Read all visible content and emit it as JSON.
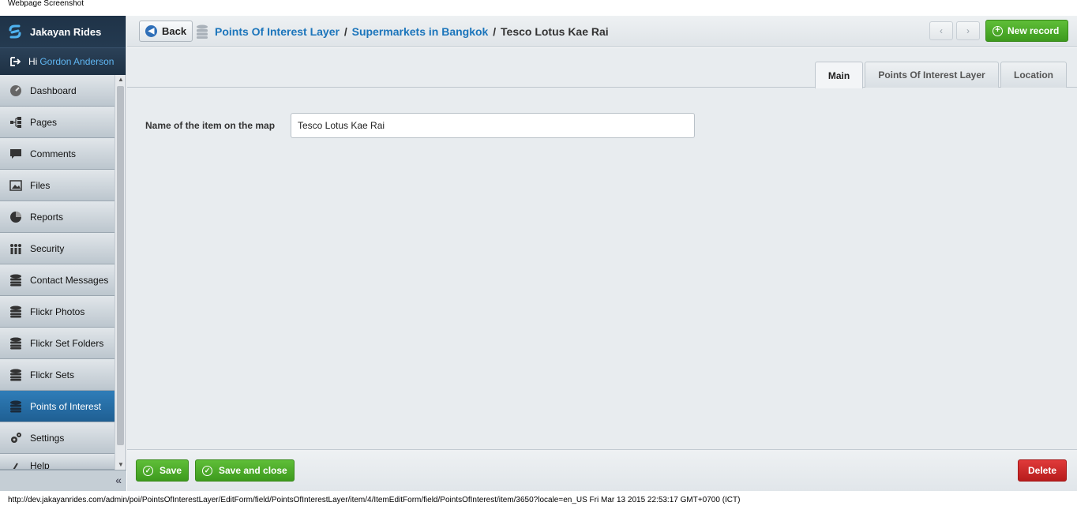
{
  "window": {
    "caption": "Webpage Screenshot"
  },
  "app": {
    "name": "Jakayan Rides"
  },
  "user": {
    "greeting": "Hi",
    "name": "Gordon Anderson"
  },
  "sidebar": {
    "items": [
      {
        "label": "Dashboard",
        "icon": "dashboard-icon"
      },
      {
        "label": "Pages",
        "icon": "sitemap-icon"
      },
      {
        "label": "Comments",
        "icon": "comment-icon"
      },
      {
        "label": "Files",
        "icon": "image-icon"
      },
      {
        "label": "Reports",
        "icon": "pie-chart-icon"
      },
      {
        "label": "Security",
        "icon": "users-icon"
      },
      {
        "label": "Contact Messages",
        "icon": "database-icon"
      },
      {
        "label": "Flickr Photos",
        "icon": "database-icon"
      },
      {
        "label": "Flickr Set Folders",
        "icon": "database-icon"
      },
      {
        "label": "Flickr Sets",
        "icon": "database-icon"
      },
      {
        "label": "Points of Interest",
        "icon": "database-icon",
        "active": true
      },
      {
        "label": "Settings",
        "icon": "gear-icon"
      },
      {
        "label": "Help",
        "icon": "help-icon"
      }
    ],
    "collapse_label": "«"
  },
  "header": {
    "back_label": "Back",
    "breadcrumb": {
      "part1": "Points Of Interest Layer",
      "sep1": "/",
      "part2": "Supermarkets in Bangkok",
      "sep2": "/",
      "current": "Tesco Lotus Kae Rai"
    },
    "prev_label": "‹",
    "next_label": "›",
    "new_record_label": "New record"
  },
  "tabs": [
    {
      "label": "Main",
      "active": true
    },
    {
      "label": "Points Of Interest Layer",
      "active": false
    },
    {
      "label": "Location",
      "active": false
    }
  ],
  "form": {
    "name_label": "Name of the item on the map",
    "name_value": "Tesco Lotus Kae Rai"
  },
  "footer": {
    "save_label": "Save",
    "save_close_label": "Save and close",
    "delete_label": "Delete"
  },
  "status": {
    "url_line": "http://dev.jakayanrides.com/admin/poi/PointsOfInterestLayer/EditForm/field/PointsOfInterestLayer/item/4/ItemEditForm/field/PointsOfInterest/item/3650?locale=en_US Fri Mar 13 2015 22:53:17 GMT+0700 (ICT)"
  },
  "colors": {
    "accent": "#1b75bb",
    "sidebar_dark": "#243a50",
    "green": "#4caf2a",
    "red": "#c62828"
  }
}
